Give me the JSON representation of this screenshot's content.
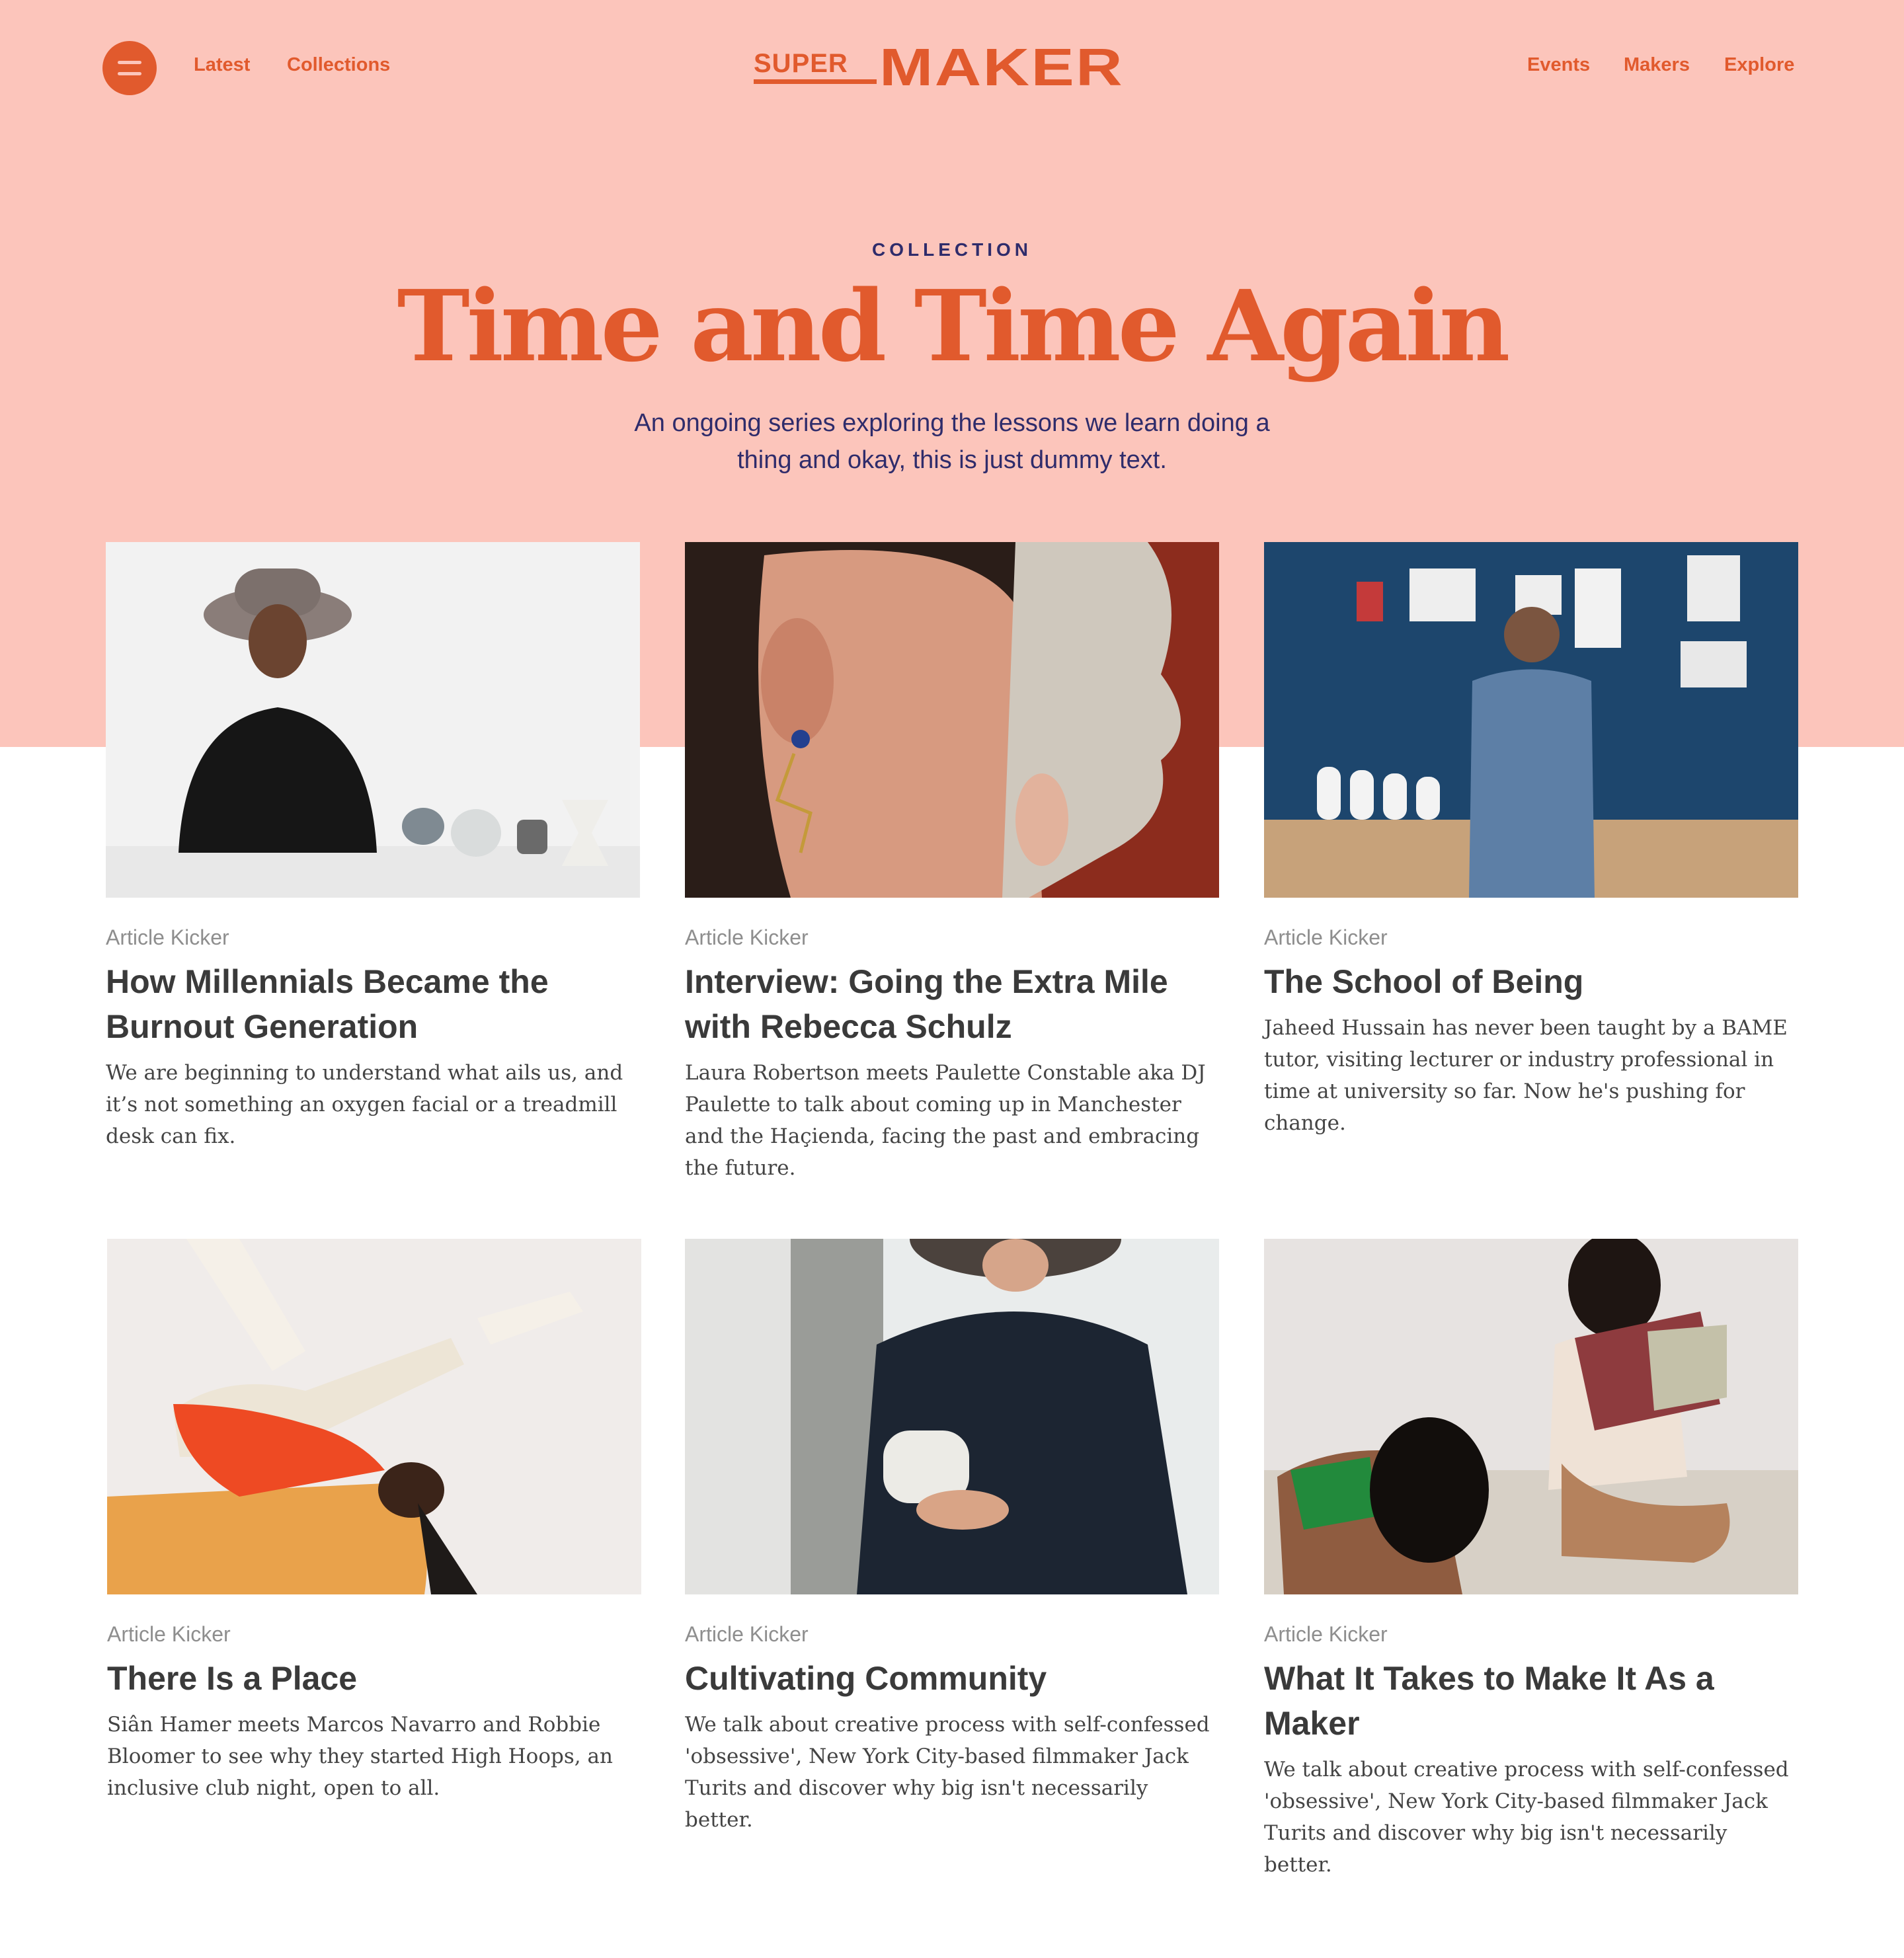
{
  "nav": {
    "menu_icon": "hamburger-menu-icon",
    "left_links": [
      "Latest",
      "Collections"
    ],
    "right_links": [
      "Events",
      "Makers",
      "Explore"
    ],
    "logo": {
      "super": "SUPER",
      "maker": "MAKER"
    }
  },
  "hero": {
    "kicker": "COLLECTION",
    "title": "Time and Time Again",
    "subtitle": "An ongoing series exploring the lessons we learn doing a thing and okay, this is just dummy text."
  },
  "cards": [
    {
      "kicker": "Article Kicker",
      "title": "How Millennials Became the Burnout Generation",
      "excerpt": "We are beginning to understand what ails us, and it’s not something an oxygen facial or a treadmill desk can fix."
    },
    {
      "kicker": "Article Kicker",
      "title": "Interview: Going the Extra Mile with Rebecca Schulz",
      "excerpt": "Laura Robertson meets Paulette Constable aka DJ Paulette to talk about coming up in Manchester and the Haçienda, facing the past and embracing the future."
    },
    {
      "kicker": "Article Kicker",
      "title": "The School of Being",
      "excerpt": "Jaheed Hussain has never been taught by a BAME tutor, visiting lecturer or industry professional in time at university so far. Now he's pushing for change."
    },
    {
      "kicker": "Article Kicker",
      "title": "There Is a Place",
      "excerpt": "Siân Hamer meets Marcos Navarro and Robbie Bloomer to see why they started High Hoops, an inclusive club night, open to all."
    },
    {
      "kicker": "Article Kicker",
      "title": "Cultivating Community",
      "excerpt": "We talk about creative process with self-confessed 'obsessive', New York City-based filmmaker Jack Turits and discover why big isn't necessarily better."
    },
    {
      "kicker": "Article Kicker",
      "title": "What It Takes to Make It As a Maker",
      "excerpt": "We talk about creative process with self-confessed 'obsessive', New York City-based filmmaker Jack Turits and discover why big isn't necessarily better."
    }
  ],
  "colors": {
    "hero_bg": "#fcc5bb",
    "accent": "#e15a2d",
    "navy": "#2f2c6b",
    "kicker_gray": "#8e8e8e",
    "heading": "#3a3a3a"
  }
}
